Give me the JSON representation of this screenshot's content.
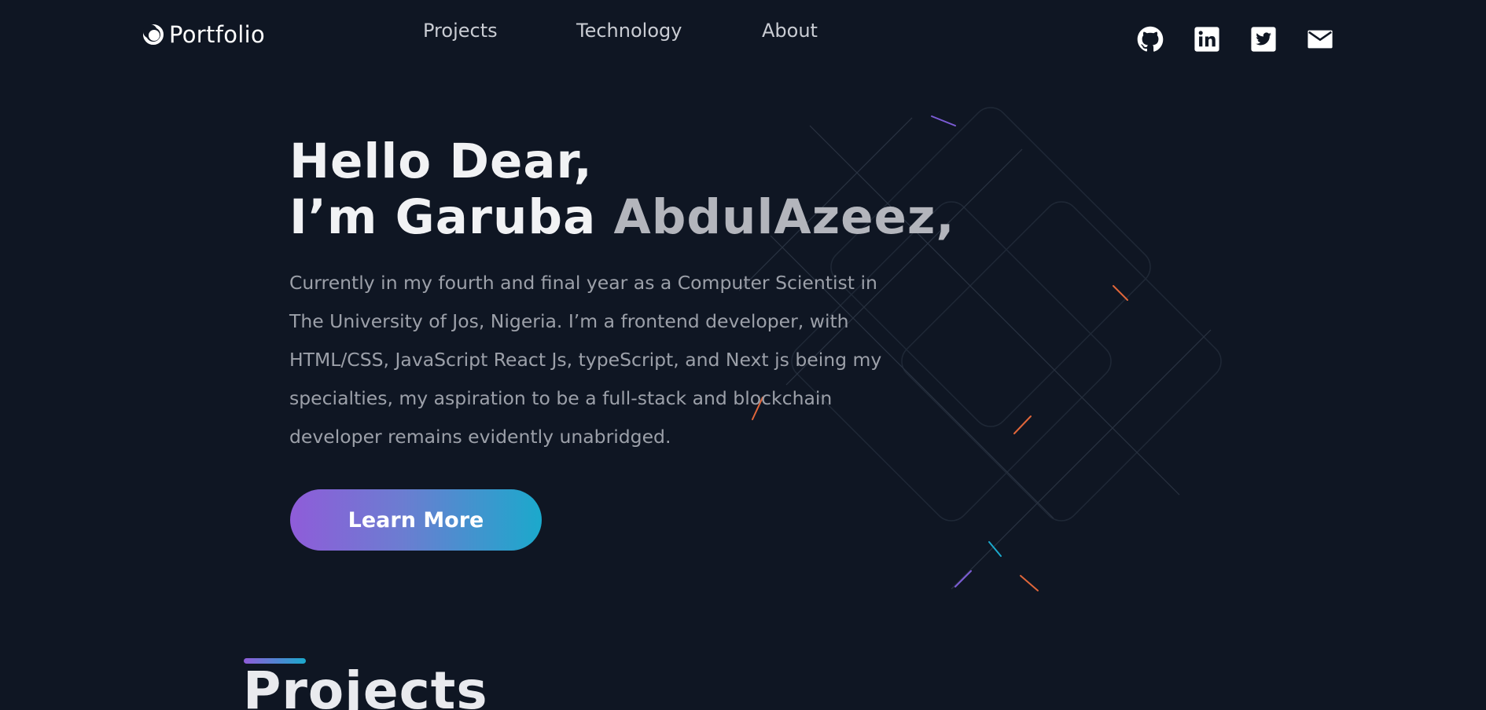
{
  "header": {
    "logo_text": "Portfolio",
    "logo_icon": "crescent-logo-icon",
    "nav": [
      {
        "label": "Projects"
      },
      {
        "label": "Technology"
      },
      {
        "label": "About"
      }
    ],
    "socials": [
      {
        "icon": "github-icon"
      },
      {
        "icon": "linkedin-icon"
      },
      {
        "icon": "twitter-icon"
      },
      {
        "icon": "mail-icon"
      }
    ]
  },
  "hero": {
    "greeting": "Hello Dear,",
    "intro_prefix": "I’m Garuba ",
    "intro_name": "AbdulAzeez,",
    "description": " Currently in my fourth and final year as a Computer Scientist in The University of Jos, Nigeria. I’m a frontend developer, with HTML/CSS, JavaScript React Js, typeScript, and Next js being my specialties, my aspiration to be a full-stack and blockchain developer remains evidently unabridged.",
    "cta_label": "Learn More"
  },
  "projects_section": {
    "title": "Projects"
  },
  "colors": {
    "background": "#0f1623",
    "gradient_start": "#8f5cd9",
    "gradient_end": "#1ba9cc"
  }
}
